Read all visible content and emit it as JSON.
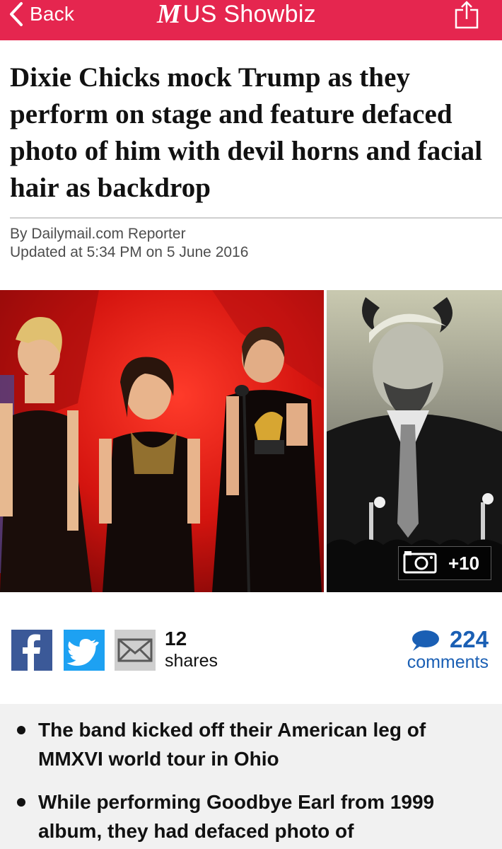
{
  "header": {
    "back_label": "Back",
    "brand_logo": "M",
    "section_title": "US Showbiz",
    "accent_color": "#e5264f",
    "share_icon": "share-icon"
  },
  "article": {
    "headline": "Dixie Chicks mock Trump as they perform on stage and feature defaced photo of him with devil horns and facial hair as backdrop",
    "byline": "By Dailymail.com Reporter",
    "updated": "Updated at 5:34 PM on 5 June 2016"
  },
  "media": {
    "main_photo_icon": "photo-trio-on-stage",
    "side_photo_icon": "photo-defaced-portrait-backdrop",
    "gallery_icon": "camera-icon",
    "gallery_more": "+10"
  },
  "share": {
    "facebook_icon": "facebook-icon",
    "twitter_icon": "twitter-icon",
    "email_icon": "email-icon",
    "count": "12",
    "label": "shares"
  },
  "comments": {
    "icon": "speech-bubble-icon",
    "count": "224",
    "label": "comments",
    "link_color": "#1a5fb4"
  },
  "summary": {
    "bullets": [
      "The band kicked off their American leg of MMXVI world tour in Ohio",
      "While performing Goodbye Earl from 1999 album, they had defaced photo of"
    ]
  }
}
